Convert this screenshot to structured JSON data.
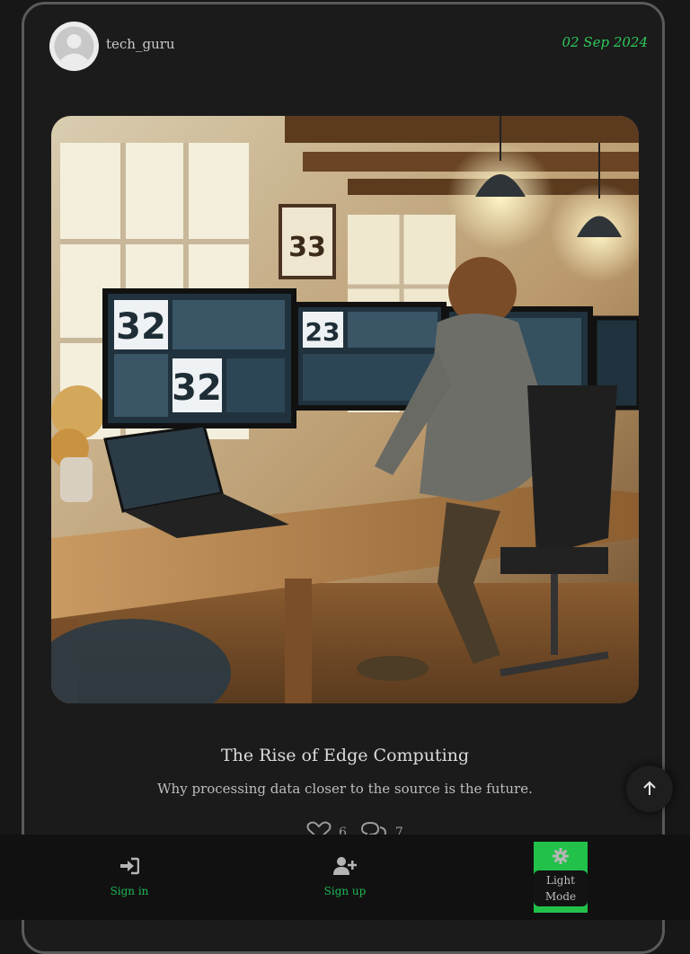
{
  "post": {
    "author": "tech_guru",
    "date": "02 Sep 2024",
    "image_alt": "Person working at a desk with multiple monitors displaying data dashboards",
    "title": "The Rise of Edge Computing",
    "subtitle": "Why processing data closer to the source is the future.",
    "likes": "6",
    "comments": "7"
  },
  "image_screen_text": [
    "32",
    "32",
    "23",
    "33"
  ],
  "nav": {
    "signin_label": "Sign in",
    "signup_label": "Sign up",
    "mode_label_line1": "Light",
    "mode_label_line2": "Mode"
  },
  "icons": {
    "signin": "sign-in-icon",
    "signup": "user-plus-icon",
    "mode": "gear-icon",
    "like": "heart-icon",
    "comment": "comments-icon",
    "scroll": "arrow-up-icon"
  },
  "colors": {
    "accent": "#22c24a",
    "date": "#2fc95a",
    "background": "#171717"
  }
}
